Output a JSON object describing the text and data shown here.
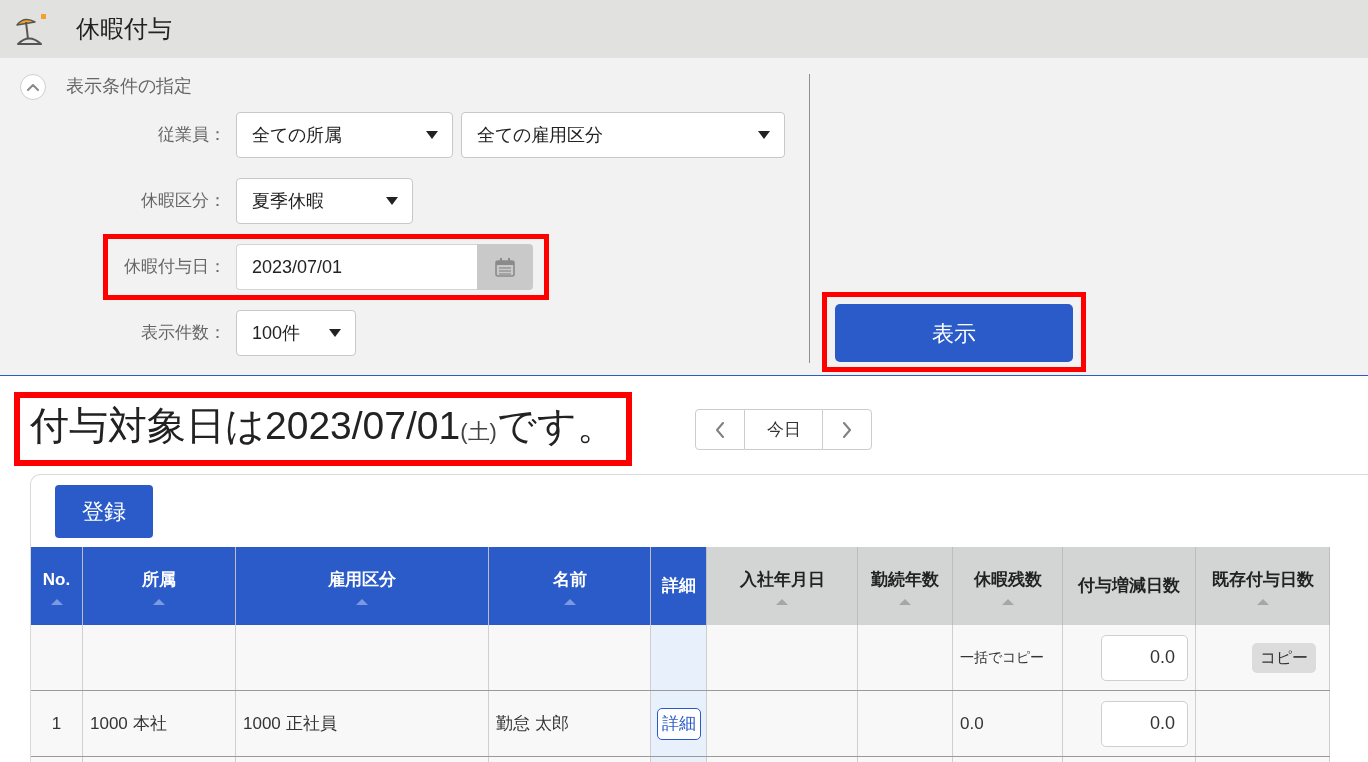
{
  "header": {
    "title": "休暇付与"
  },
  "filters": {
    "expanded": true,
    "toggle_label": "表示条件の指定",
    "fields": [
      {
        "kind": "select_group",
        "label": "従業員：",
        "highlighted": false,
        "selects": [
          {
            "value": "全ての所属"
          },
          {
            "value": "全ての雇用区分"
          }
        ]
      },
      {
        "kind": "select_group",
        "label": "休暇区分：",
        "highlighted": false,
        "selects": [
          {
            "value": "夏季休暇"
          }
        ]
      },
      {
        "kind": "date",
        "label": "休暇付与日：",
        "highlighted": true,
        "value": "2023/07/01"
      },
      {
        "kind": "select_group",
        "label": "表示件数：",
        "highlighted": false,
        "selects": [
          {
            "value": "100件"
          }
        ]
      }
    ],
    "submit": {
      "label": "表示",
      "highlighted": true
    }
  },
  "result": {
    "heading": {
      "text": "付与対象日は2023/07/01",
      "weekday": "(土)",
      "suffix": "です。",
      "highlighted": true
    },
    "date_nav": {
      "today_label": "今日"
    }
  },
  "register_button": {
    "label": "登録"
  },
  "table": {
    "columns": [
      {
        "label": "No.",
        "frozen": true,
        "sortable": true
      },
      {
        "label": "所属",
        "frozen": true,
        "sortable": true
      },
      {
        "label": "雇用区分",
        "frozen": true,
        "sortable": true
      },
      {
        "label": "名前",
        "frozen": true,
        "sortable": true
      },
      {
        "label": "詳細",
        "frozen": true,
        "sortable": false
      },
      {
        "label": "入社年月日",
        "frozen": false,
        "sortable": true
      },
      {
        "label": "勤続年数",
        "frozen": false,
        "sortable": true
      },
      {
        "label": "休暇残数",
        "frozen": false,
        "sortable": true
      },
      {
        "label": "付与増減日数",
        "frozen": false,
        "sortable": false
      },
      {
        "label": "既存付与日数",
        "frozen": false,
        "sortable": true
      }
    ],
    "rows": [
      {
        "remaining_days": {
          "kind": "note",
          "text": "一括でコピー"
        },
        "grant_adjustment": {
          "kind": "input",
          "value": "0.0"
        },
        "existing_grant_days": {
          "kind": "button",
          "label": "コピー"
        }
      },
      {
        "no": {
          "kind": "text",
          "text": "1"
        },
        "department": {
          "kind": "text",
          "text": "1000 本社"
        },
        "employment_type": {
          "kind": "text",
          "text": "1000 正社員"
        },
        "name": {
          "kind": "text",
          "text": "勤怠 太郎"
        },
        "detail": {
          "kind": "outline_button",
          "label": "詳細"
        },
        "remaining_days": {
          "kind": "text",
          "text": "0.0"
        },
        "grant_adjustment": {
          "kind": "input",
          "value": "0.0"
        }
      }
    ]
  }
}
